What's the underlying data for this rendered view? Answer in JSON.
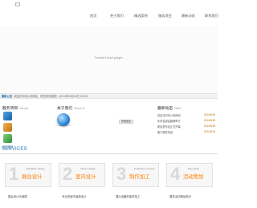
{
  "nav": {
    "items": [
      "首页",
      "关于我们",
      "精选案例",
      "服务项目",
      "最新动态",
      "联系我们"
    ]
  },
  "hero": {
    "message": "Couldn't load plugin."
  },
  "news_bar": {
    "label": "最新公告",
    "text": "欢迎访问本公司网站，祝您浏览愉快！(2014年03月18日 10:00)"
  },
  "services": {
    "title": "服务项目",
    "subtitle": "Service",
    "link": "网站首页",
    "heading": "SERVICES"
  },
  "about": {
    "title": "关于我们",
    "subtitle": "About us",
    "more_label": "查看更多"
  },
  "news": {
    "title": "最新动态",
    "subtitle": "News",
    "items": [
      {
        "title": "欢迎访问本公司网站",
        "date": "2014/3/18"
      },
      {
        "title": "年终答谢会圆满举行",
        "date": "2014/3/18"
      },
      {
        "title": "新品发布会正式开幕",
        "date": "2014/3/18"
      },
      {
        "title": "客户服务热线",
        "date": "2014/3/18"
      }
    ]
  },
  "cards": [
    {
      "num": "1",
      "en": "Exhibition design",
      "cn": "展台设计",
      "label": "展台设计无局限"
    },
    {
      "num": "2",
      "en": "Interior design",
      "cn": "室内设计",
      "label": "专业的室内装修设计"
    },
    {
      "num": "3",
      "en": "Production process",
      "cn": "制作加工",
      "label": "展示设备的制作加工"
    },
    {
      "num": "4",
      "en": "Event plan",
      "cn": "活动策划",
      "label": "展览活动策划执行"
    }
  ],
  "colors": {
    "accent": "#1e6ea3",
    "card_title": "#ff7f00"
  }
}
